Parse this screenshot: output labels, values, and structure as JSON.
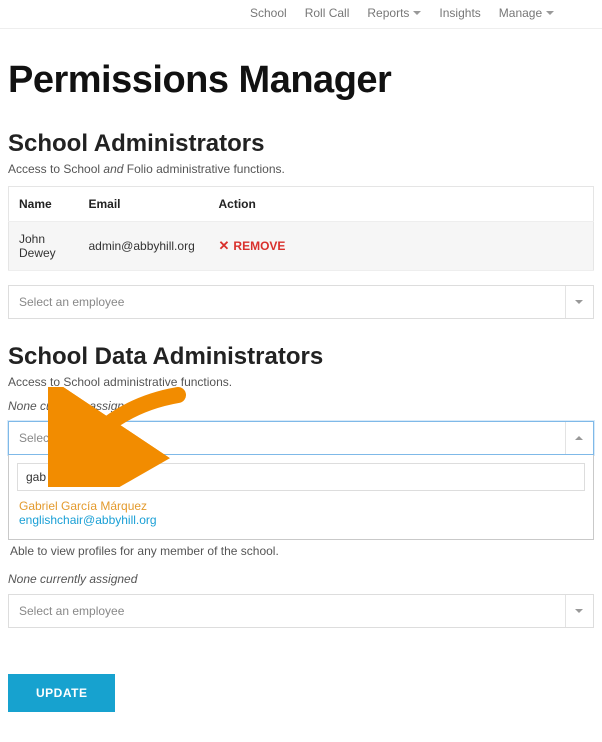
{
  "nav": {
    "school": "School",
    "rollcall": "Roll Call",
    "reports": "Reports",
    "insights": "Insights",
    "manage": "Manage"
  },
  "page": {
    "title": "Permissions Manager"
  },
  "section1": {
    "title": "School Administrators",
    "desc_pre": "Access to School ",
    "desc_em": "and",
    "desc_post": " Folio administrative functions.",
    "table": {
      "headers": {
        "name": "Name",
        "email": "Email",
        "action": "Action"
      },
      "rows": [
        {
          "name": "John Dewey",
          "email": "admin@abbyhill.org",
          "action": "REMOVE"
        }
      ]
    },
    "select_placeholder": "Select an employee"
  },
  "section2": {
    "title": "School Data Administrators",
    "desc": "Access to School administrative functions.",
    "assigned": "None currently assigned",
    "select_placeholder": "Select an employee",
    "search_value": "gab",
    "result": {
      "name": "Gabriel García Márquez",
      "email": "englishchair@abbyhill.org"
    },
    "under_text": "Able to view profiles for any member of the school."
  },
  "section3": {
    "assigned": "None currently assigned",
    "select_placeholder": "Select an employee"
  },
  "buttons": {
    "update": "UPDATE"
  }
}
